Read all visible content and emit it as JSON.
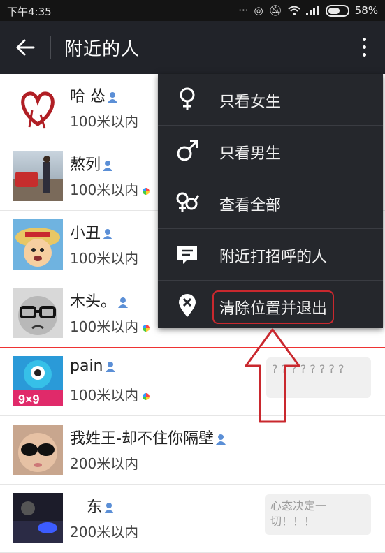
{
  "status": {
    "time": "下午4:35",
    "battery": "58%"
  },
  "header": {
    "title": "附近的人"
  },
  "menu": [
    {
      "icon": "female-icon",
      "label": "只看女生"
    },
    {
      "icon": "male-icon",
      "label": "只看男生"
    },
    {
      "icon": "all-genders-icon",
      "label": "查看全部"
    },
    {
      "icon": "message-icon",
      "label": "附近打招呼的人"
    },
    {
      "icon": "location-clear-icon",
      "label": "清除位置并退出"
    }
  ],
  "people": [
    {
      "name": "哈 怂",
      "distance": "100米以内",
      "moment": false,
      "note": ""
    },
    {
      "name": "熬列",
      "distance": "100米以内",
      "moment": true,
      "note": ""
    },
    {
      "name": "小丑",
      "distance": "100米以内",
      "moment": false,
      "note": ""
    },
    {
      "name": "木头。",
      "distance": "100米以内",
      "moment": true,
      "note": ""
    },
    {
      "name": "pain",
      "distance": "100米以内",
      "moment": true,
      "note": "? ? ? ? ? ? ? ?"
    },
    {
      "name": "我姓王-却不住你隔壁",
      "distance": "200米以内",
      "moment": false,
      "note": ""
    },
    {
      "name": "东",
      "distance": "200米以内",
      "moment": false,
      "note": "心态决定一切！！！"
    }
  ],
  "colors": {
    "header_bg": "#212329",
    "menu_bg": "#25272c",
    "highlight": "#c9282e",
    "arrow": "#c9282e"
  }
}
